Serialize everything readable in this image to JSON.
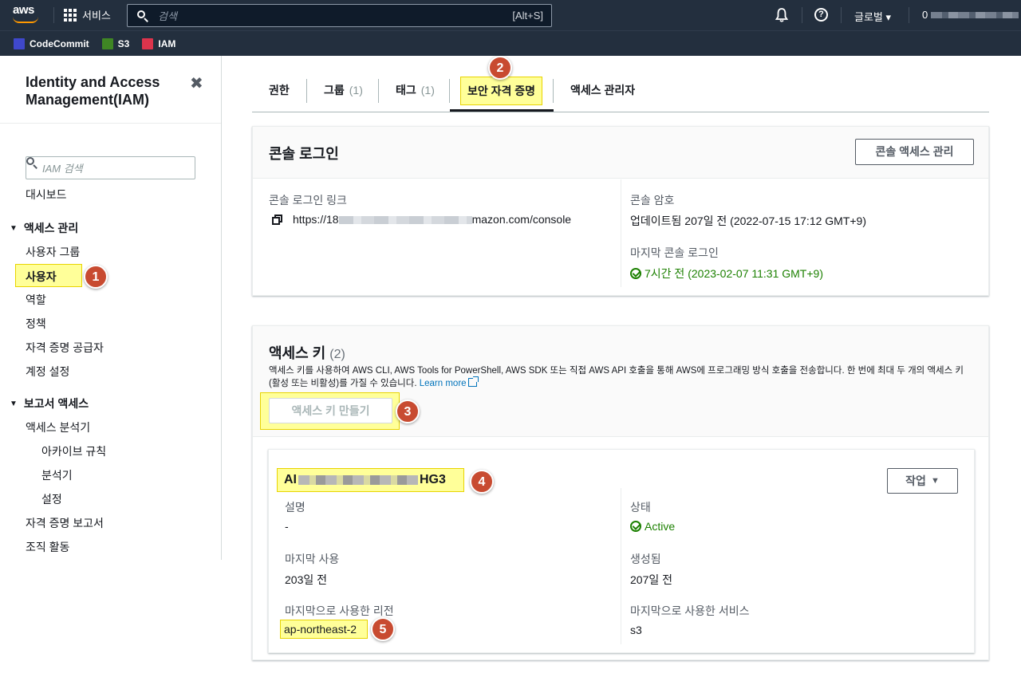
{
  "topnav": {
    "logo_text": "aws",
    "services_label": "서비스",
    "search_placeholder": "검색",
    "search_shortcut": "[Alt+S]",
    "region_label": "글로벌 ▾",
    "account_prefix": "0"
  },
  "favorites": [
    {
      "label": "CodeCommit",
      "color": "#3f48cc"
    },
    {
      "label": "S3",
      "color": "#3f8624"
    },
    {
      "label": "IAM",
      "color": "#dd344c"
    }
  ],
  "sidebar": {
    "title": "Identity and Access Management(IAM)",
    "close": "✖",
    "search_placeholder": "IAM 검색",
    "dashboard": "대시보드",
    "section_access": "액세스 관리",
    "access_items": [
      "사용자 그룹",
      "사용자",
      "역할",
      "정책",
      "자격 증명 공급자",
      "계정 설정"
    ],
    "section_reports": "보고서 액세스",
    "report_items": [
      "액세스 분석기",
      "아카이브 규칙",
      "분석기",
      "설정",
      "자격 증명 보고서",
      "조직 활동"
    ]
  },
  "badges": [
    "1",
    "2",
    "3",
    "4",
    "5"
  ],
  "tabs": [
    {
      "label": "권한",
      "count": ""
    },
    {
      "label": "그룹",
      "count": "(1)"
    },
    {
      "label": "태그",
      "count": "(1)"
    },
    {
      "label": "보안 자격 증명",
      "count": ""
    },
    {
      "label": "액세스 관리자",
      "count": ""
    }
  ],
  "console_login": {
    "title": "콘솔 로그인",
    "manage_button": "콘솔 액세스 관리",
    "link_label": "콘솔 로그인 링크",
    "link_prefix": "https://18",
    "link_suffix": "mazon.com/console",
    "password_label": "콘솔 암호",
    "password_value": "업데이트됨 207일 전 (2022-07-15 17:12 GMT+9)",
    "last_login_label": "마지막 콘솔 로그인",
    "last_login_value": "7시간 전 (2023-02-07 11:31 GMT+9)"
  },
  "access_keys": {
    "title": "액세스 키",
    "count": "(2)",
    "description": "액세스 키를 사용하여 AWS CLI, AWS Tools for PowerShell, AWS SDK 또는 직접 AWS API 호출을 통해 AWS에 프로그래밍 방식 호출을 전송합니다. 한 번에 최대 두 개의 액세스 키(활성 또는 비활성)를 가질 수 있습니다.",
    "learn_more": "Learn more",
    "create_button": "액세스 키 만들기",
    "key": {
      "id_prefix": "AI",
      "id_suffix": "HG3",
      "action_button": "작업",
      "desc_label": "설명",
      "desc_value": "-",
      "status_label": "상태",
      "status_value": "Active",
      "last_used_label": "마지막 사용",
      "last_used_value": "203일 전",
      "created_label": "생성됨",
      "created_value": "207일 전",
      "last_region_label": "마지막으로 사용한 리전",
      "last_region_value": "ap-northeast-2",
      "last_service_label": "마지막으로 사용한 서비스",
      "last_service_value": "s3"
    }
  }
}
